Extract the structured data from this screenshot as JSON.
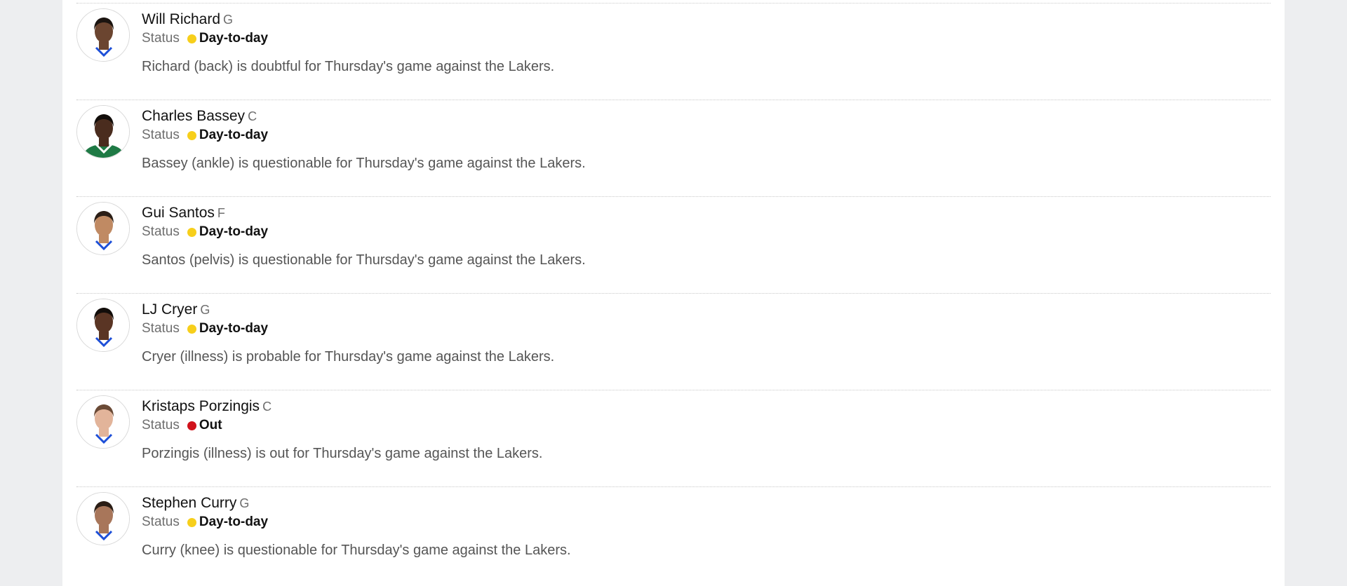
{
  "status_label": "Status",
  "status_colors": {
    "Day-to-day": "#f7cf1b",
    "Out": "#d0121b"
  },
  "players": [
    {
      "name": "Will Richard",
      "position": "G",
      "status": "Day-to-day",
      "note": "Richard (back) is doubtful for Thursday's game against the Lakers.",
      "avatar": {
        "skin": "#6b4530",
        "hair": "#1b1410",
        "jersey": "#ffffff",
        "trim": "#1d4fd8"
      }
    },
    {
      "name": "Charles Bassey",
      "position": "C",
      "status": "Day-to-day",
      "note": "Bassey (ankle) is questionable for Thursday's game against the Lakers.",
      "avatar": {
        "skin": "#4a2c1e",
        "hair": "#120d0a",
        "jersey": "#1f7a45",
        "trim": "#ffffff"
      }
    },
    {
      "name": "Gui Santos",
      "position": "F",
      "status": "Day-to-day",
      "note": "Santos (pelvis) is questionable for Thursday's game against the Lakers.",
      "avatar": {
        "skin": "#c08a63",
        "hair": "#2b1e16",
        "jersey": "#ffffff",
        "trim": "#1d4fd8"
      }
    },
    {
      "name": "LJ Cryer",
      "position": "G",
      "status": "Day-to-day",
      "note": "Cryer (illness) is probable for Thursday's game against the Lakers.",
      "avatar": {
        "skin": "#5a3524",
        "hair": "#120d0a",
        "jersey": "#ffffff",
        "trim": "#1d4fd8"
      }
    },
    {
      "name": "Kristaps Porzingis",
      "position": "C",
      "status": "Out",
      "note": "Porzingis (illness) is out for Thursday's game against the Lakers.",
      "avatar": {
        "skin": "#e2b49a",
        "hair": "#6a4a36",
        "jersey": "#ffffff",
        "trim": "#1d4fd8"
      }
    },
    {
      "name": "Stephen Curry",
      "position": "G",
      "status": "Day-to-day",
      "note": "Curry (knee) is questionable for Thursday's game against the Lakers.",
      "avatar": {
        "skin": "#a8765a",
        "hair": "#2a1d15",
        "jersey": "#ffffff",
        "trim": "#1d4fd8"
      }
    }
  ]
}
